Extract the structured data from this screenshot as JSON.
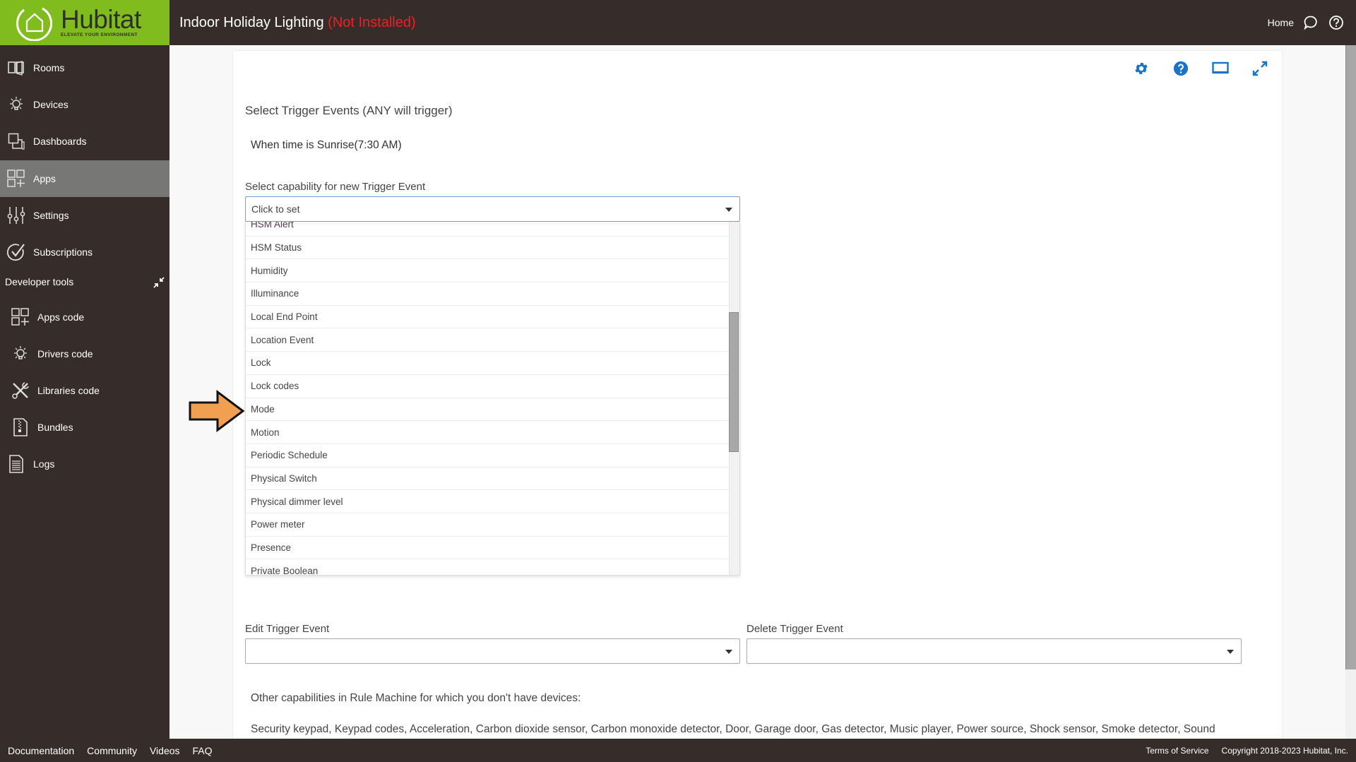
{
  "app": {
    "brand": "Hubitat",
    "tagline": "ELEVATE YOUR ENVIRONMENT",
    "title": "Indoor Holiday Lighting",
    "title_status": "(Not Installed)",
    "title_status_color": "#ee2020",
    "brand_color": "#80bc1e"
  },
  "header": {
    "home_label": "Home",
    "icons": [
      "chat-icon",
      "help-icon"
    ]
  },
  "sidebar": {
    "items": [
      {
        "label": "Rooms",
        "icon": "rooms-icon",
        "active": false
      },
      {
        "label": "Devices",
        "icon": "lightbulb-icon",
        "active": false
      },
      {
        "label": "Dashboards",
        "icon": "dashboards-icon",
        "active": false
      },
      {
        "label": "Apps",
        "icon": "apps-icon",
        "active": true
      },
      {
        "label": "Settings",
        "icon": "sliders-icon",
        "active": false
      },
      {
        "label": "Subscriptions",
        "icon": "check-circle-icon",
        "active": false
      }
    ],
    "dev_header": "Developer tools",
    "dev_items": [
      {
        "label": "Apps code",
        "icon": "apps-icon"
      },
      {
        "label": "Drivers code",
        "icon": "lightbulb-icon"
      },
      {
        "label": "Libraries code",
        "icon": "tools-icon"
      },
      {
        "label": "Bundles",
        "icon": "zip-file-icon"
      }
    ],
    "logs": {
      "label": "Logs",
      "icon": "document-icon"
    }
  },
  "panel": {
    "tool_icons": [
      "gear-icon",
      "help-icon",
      "monitor-icon",
      "expand-icon"
    ],
    "section_title": "Select Trigger Events (ANY will trigger)",
    "existing_trigger": "When time is Sunrise(7:30 AM)",
    "capability_label": "Select capability for new Trigger Event",
    "capability_placeholder": "Click to set",
    "capability_options": [
      "HSM Alert",
      "HSM Status",
      "Humidity",
      "Illuminance",
      "Local End Point",
      "Location Event",
      "Lock",
      "Lock codes",
      "Mode",
      "Motion",
      "Periodic Schedule",
      "Physical Switch",
      "Physical dimmer level",
      "Power meter",
      "Presence",
      "Private Boolean"
    ],
    "highlighted_option": "Mode",
    "dropdown_scroll": {
      "thumb_start_fraction": 0.255,
      "thumb_size_fraction": 0.395
    },
    "edit_label": "Edit Trigger Event",
    "edit_value": "",
    "delete_label": "Delete Trigger Event",
    "delete_value": "",
    "other_capabilities_label": "Other capabilities in Rule Machine for which you don't have devices:",
    "other_capabilities_list": "Security keypad, Keypad codes, Acceleration, Carbon dioxide sensor, Carbon monoxide detector, Door, Garage door, Gas detector, Music player, Power source, Shock sensor, Smoke detector, Sound"
  },
  "annotation": {
    "type": "arrow",
    "color": "#f0a050",
    "points_to": "Mode"
  },
  "footer": {
    "left_links": [
      "Documentation",
      "Community",
      "Videos",
      "FAQ"
    ],
    "terms": "Terms of Service",
    "copyright": "Copyright 2018-2023 Hubitat, Inc."
  }
}
